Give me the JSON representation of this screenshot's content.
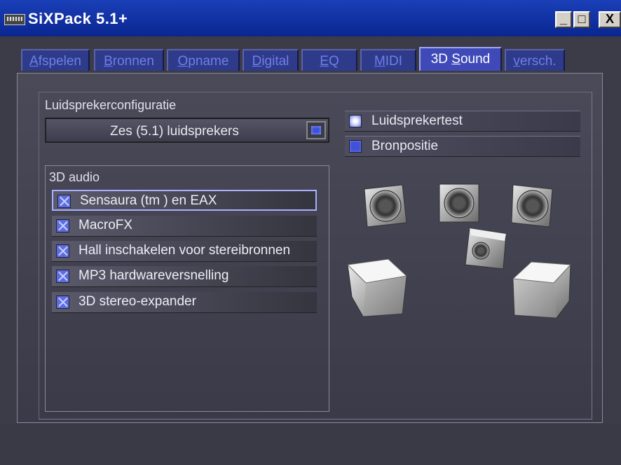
{
  "window": {
    "title": "SiXPack 5.1+",
    "controls": {
      "minimize": "_",
      "maximize": "□",
      "close": "X"
    }
  },
  "tabs": [
    {
      "label": "Afspelen",
      "underline": "A",
      "rest": "fspelen",
      "active": false
    },
    {
      "label": "Bronnen",
      "underline": "B",
      "rest": "ronnen",
      "active": false
    },
    {
      "label": "Opname",
      "underline": "O",
      "rest": "pname",
      "active": false
    },
    {
      "label": "Digital",
      "underline": "D",
      "rest": "igital",
      "active": false
    },
    {
      "label": "EQ",
      "underline": "E",
      "rest": "Q",
      "active": false
    },
    {
      "label": "MIDI",
      "underline": "M",
      "rest": "IDI",
      "active": false
    },
    {
      "label": "3D Sound",
      "pre": "3D ",
      "underline": "S",
      "rest": "ound",
      "active": true
    },
    {
      "label": "versch.",
      "underline": "v",
      "rest": "ersch.",
      "active": false
    }
  ],
  "speaker_config": {
    "label": "Luidsprekerconfiguratie",
    "selected": "Zes (5.1) luidsprekers"
  },
  "buttons": {
    "speaker_test": "Luidsprekertest",
    "source_position": "Bronpositie"
  },
  "audio3d": {
    "label": "3D audio",
    "options": [
      {
        "label": "Sensaura (tm ) en EAX",
        "checked": true
      },
      {
        "label": "MacroFX",
        "checked": true
      },
      {
        "label": "Hall inschakelen voor stereibronnen",
        "checked": true
      },
      {
        "label": "MP3 hardwareversnelling",
        "checked": true
      },
      {
        "label": "3D stereo-expander",
        "checked": true
      }
    ]
  },
  "colors": {
    "titlebar": "#0a2690",
    "tab_active": "#3f4ab8",
    "tab_inactive": "#2e3a8a",
    "panel": "#4a4a58",
    "accent": "#5d6de0"
  }
}
